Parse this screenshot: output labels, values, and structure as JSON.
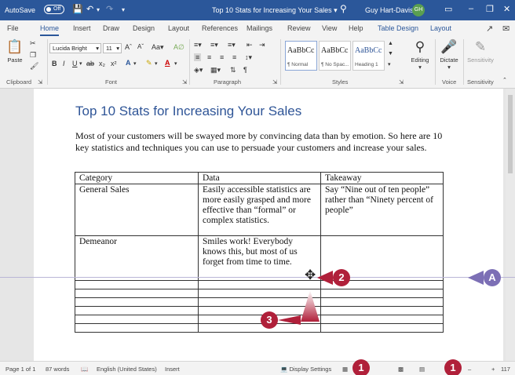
{
  "titlebar": {
    "autosave_label": "AutoSave",
    "autosave_state": "Off",
    "doc_title": "Top 10 Stats for Increasing Your Sales",
    "user_name": "Guy Hart-Davis",
    "user_initials": "GH"
  },
  "tabs": [
    "File",
    "Home",
    "Insert",
    "Draw",
    "Design",
    "Layout",
    "References",
    "Mailings",
    "Review",
    "View",
    "Help",
    "Table Design",
    "Layout"
  ],
  "active_tab": "Home",
  "ribbon": {
    "paste_label": "Paste",
    "font_name": "Lucida Bright",
    "font_size": "11",
    "group_labels": {
      "clipboard": "Clipboard",
      "font": "Font",
      "paragraph": "Paragraph",
      "styles": "Styles",
      "voice": "Voice",
      "sensitivity": "Sensitivity"
    },
    "styles": [
      {
        "sample": "AaBbCc",
        "name": "¶ Normal"
      },
      {
        "sample": "AaBbCc",
        "name": "¶ No Spac..."
      },
      {
        "sample": "AaBbCc",
        "name": "Heading 1"
      }
    ],
    "editing_label": "Editing",
    "dictate_label": "Dictate",
    "sensitivity_label": "Sensitivity"
  },
  "document": {
    "title": "Top 10 Stats for Increasing Your Sales",
    "paragraph": "Most of your customers will be swayed more by convincing data than by emotion. So here are 10 key statistics and techniques you can use to persuade your customers and increase your sales.",
    "table": {
      "headers": [
        "Category",
        "Data",
        "Takeaway"
      ],
      "rows": [
        [
          "General Sales",
          "Easily accessible statistics are more easily grasped and more effective than “formal” or complex statistics.",
          "Say “Nine out of ten people” rather than “Ninety percent of people”"
        ],
        [
          "Demeanor",
          "Smiles work! Everybody knows this, but most of us forget from time to time.",
          ""
        ]
      ]
    }
  },
  "callouts": {
    "one": "1",
    "two": "2",
    "three": "3",
    "a": "A"
  },
  "statusbar": {
    "page": "Page 1 of 1",
    "words": "87 words",
    "language": "English (United States)",
    "mode": "Insert",
    "display_settings": "Display Settings",
    "zoom": "117"
  },
  "colors": {
    "titlebar": "#2b579a",
    "callout": "#b0203a",
    "callout_purple": "#7c6fb5",
    "heading": "#2f5597"
  }
}
